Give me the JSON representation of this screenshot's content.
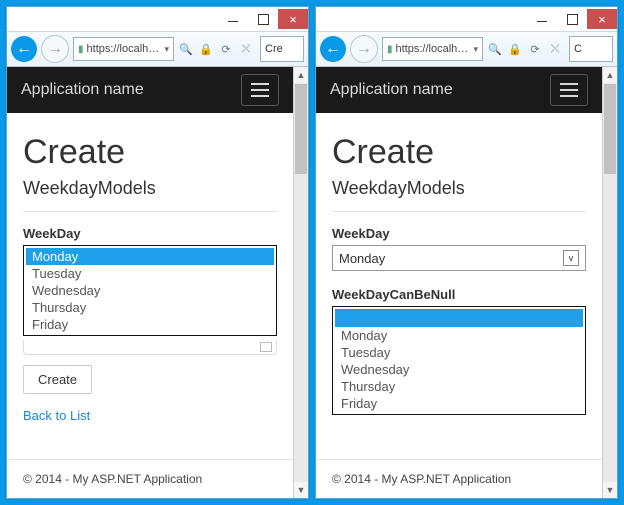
{
  "browser": {
    "url_display": "https://localh…",
    "tab_label": "Cre"
  },
  "app_header": {
    "title": "Application name"
  },
  "page": {
    "heading": "Create",
    "subtitle": "WeekdayModels",
    "footer": "© 2014 - My ASP.NET Application",
    "back_link": "Back to List",
    "create_button": "Create"
  },
  "left": {
    "field_label": "WeekDay",
    "options": [
      "Monday",
      "Tuesday",
      "Wednesday",
      "Thursday",
      "Friday"
    ],
    "selected_index": 0
  },
  "right": {
    "field1_label": "WeekDay",
    "field1_value": "Monday",
    "field2_label": "WeekDayCanBeNull",
    "options": [
      "",
      "Monday",
      "Tuesday",
      "Wednesday",
      "Thursday",
      "Friday"
    ],
    "selected_index": 0
  }
}
